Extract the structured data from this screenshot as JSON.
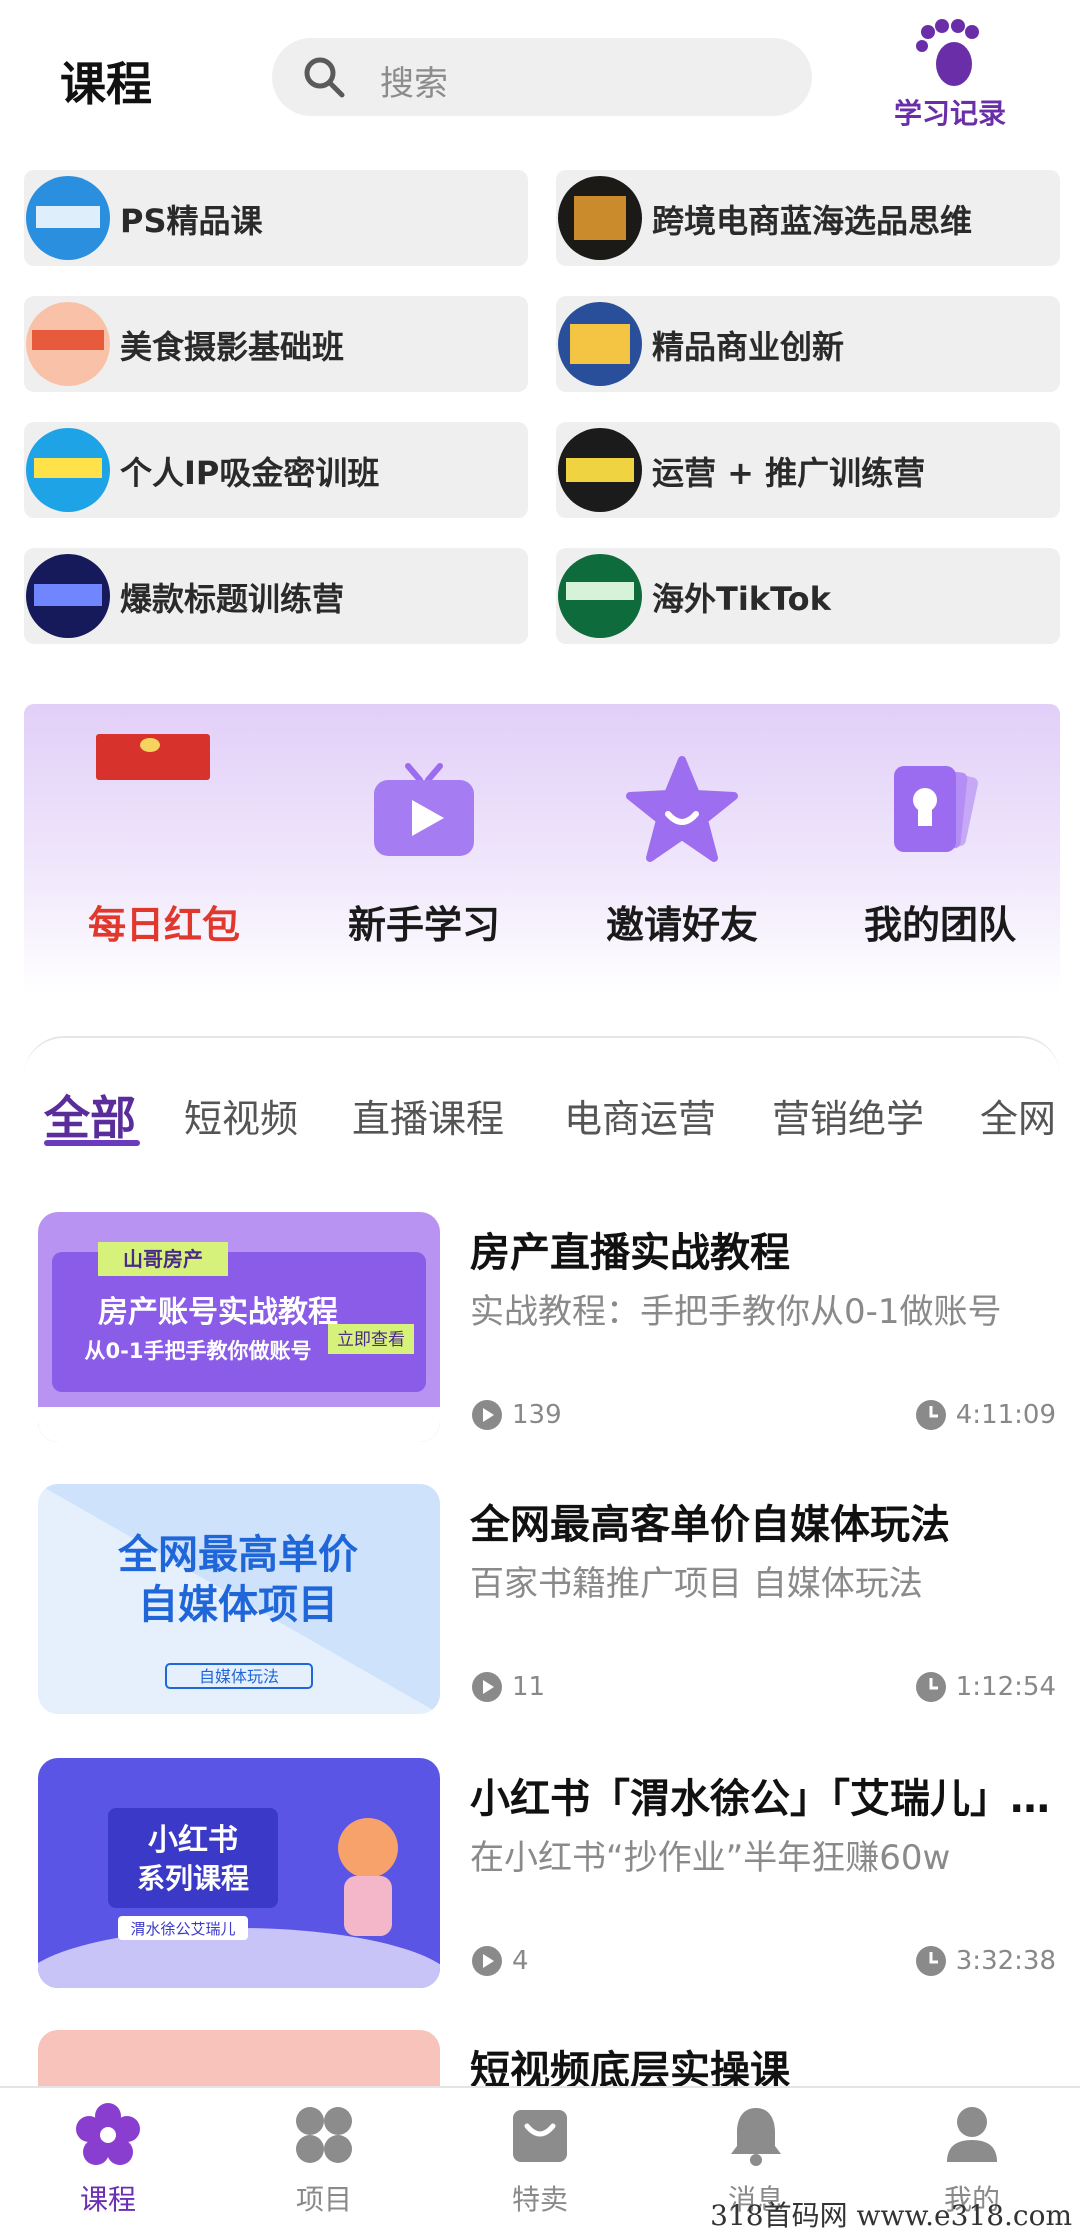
{
  "header": {
    "title": "课程",
    "search_placeholder": "搜索",
    "record_label": "学习记录"
  },
  "categories": [
    {
      "label": "PS精品课"
    },
    {
      "label": "跨境电商蓝海选品思维"
    },
    {
      "label": "美食摄影基础班"
    },
    {
      "label": "精品商业创新"
    },
    {
      "label": "个人IP吸金密训班"
    },
    {
      "label": "运营 + 推广训练营"
    },
    {
      "label": "爆款标题训练营"
    },
    {
      "label": "海外TikTok"
    }
  ],
  "quick_actions": [
    {
      "label": "每日红包"
    },
    {
      "label": "新手学习"
    },
    {
      "label": "邀请好友"
    },
    {
      "label": "我的团队"
    }
  ],
  "tabs": [
    "全部",
    "短视频",
    "直播课程",
    "电商运营",
    "营销绝学",
    "全网"
  ],
  "courses": [
    {
      "title": "房产直播实战教程",
      "subtitle": "实战教程：手把手教你从0-1做账号",
      "plays": "139",
      "duration": "4:11:09",
      "thumb_lines": [
        "山哥房产",
        "房产账号实战教程",
        "从0-1手把手教你做账号",
        "立即查看"
      ]
    },
    {
      "title": "全网最高客单价自媒体玩法",
      "subtitle": "百家书籍推广项目 自媒体玩法",
      "plays": "11",
      "duration": "1:12:54",
      "thumb_lines": [
        "全网最高单价",
        "自媒体项目",
        "自媒体玩法"
      ]
    },
    {
      "title": "小红书「渭水徐公」「艾瑞儿」系列课程",
      "subtitle": "在小红书“抄作业”半年狂赚60w",
      "plays": "4",
      "duration": "3:32:38",
      "thumb_lines": [
        "小红书",
        "系列课程",
        "渭水徐公艾瑞儿"
      ]
    },
    {
      "title": "短视频底层实操课",
      "subtitle": "",
      "plays": "",
      "duration": "",
      "thumb_lines": []
    }
  ],
  "nav": [
    {
      "label": "课程",
      "icon": "flower-icon",
      "active": true
    },
    {
      "label": "项目",
      "icon": "clover-icon",
      "active": false
    },
    {
      "label": "特卖",
      "icon": "bag-icon",
      "active": false
    },
    {
      "label": "消息",
      "icon": "bell-icon",
      "active": false
    },
    {
      "label": "我的",
      "icon": "user-icon",
      "active": false
    }
  ],
  "watermark": "318首码网  www.e318.com",
  "colors": {
    "accent": "#6b2fb3",
    "red": "#e0382d",
    "banner": "#e2cff8"
  }
}
